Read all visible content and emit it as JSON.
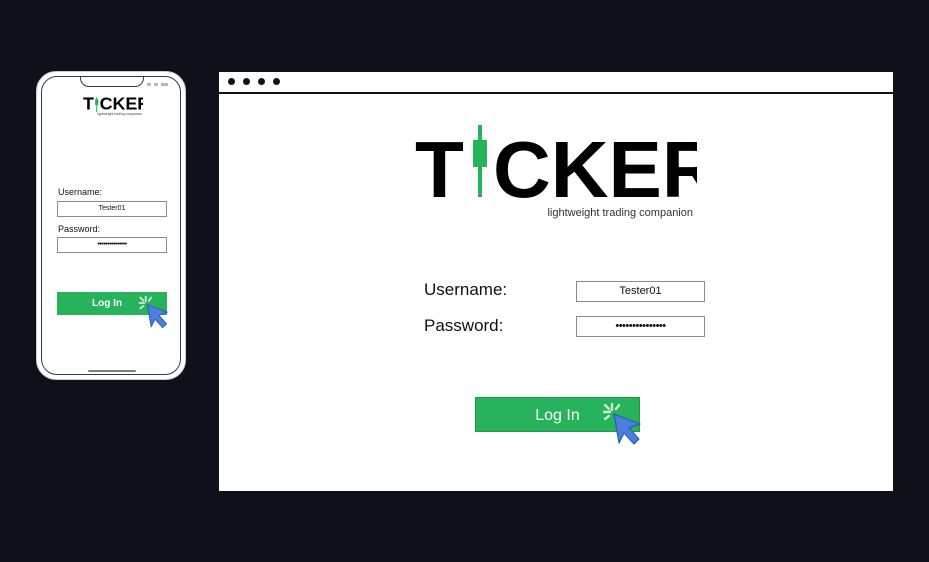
{
  "phone": {
    "brand": {
      "pre": "T",
      "post": "CKER",
      "tagline": "lightweight trading companion"
    },
    "username_label": "Username:",
    "username_value": "Tester01",
    "password_label": "Password:",
    "password_value": "•••••••••••••••",
    "login_label": "Log In"
  },
  "browser": {
    "brand": {
      "pre": "T",
      "post": "CKER",
      "tagline": "lightweight trading companion"
    },
    "username_label": "Username:",
    "username_value": "Tester01",
    "password_label": "Password:",
    "password_value": "•••••••••••••••",
    "login_label": "Log In"
  },
  "colors": {
    "background": "#0e111a",
    "accent_green": "#27b35b",
    "cursor_blue": "#4a7fdc",
    "text": "#111111"
  },
  "icons": {
    "cursor": "pointer-click-icon",
    "window_dots": "window-controls-icon"
  }
}
